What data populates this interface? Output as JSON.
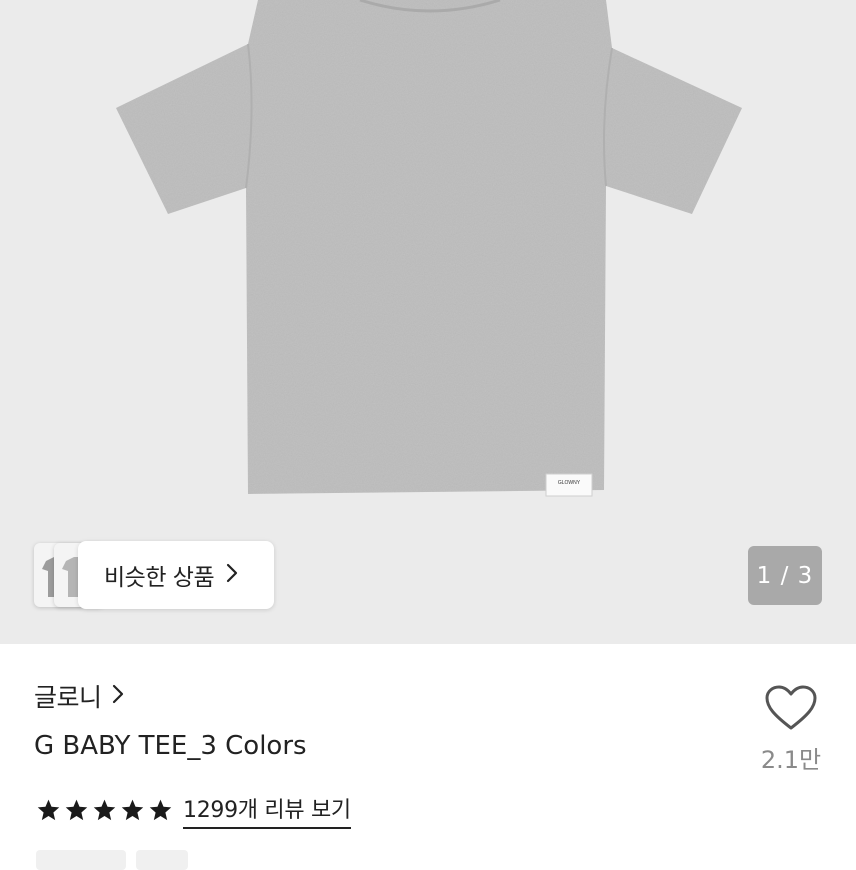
{
  "hero": {
    "image_label": "GLOWNY",
    "similar": {
      "label": "비슷한 상품",
      "icon": "chevron-right-icon"
    },
    "page_indicator": "1 / 3"
  },
  "product": {
    "brand": "글로니",
    "brand_icon": "chevron-right-icon",
    "title": "G BABY TEE_3 Colors",
    "rating": 5,
    "review_link": "1299개 리뷰 보기",
    "like_icon": "heart-outline-icon",
    "like_count": "2.1만"
  },
  "colors": {
    "background_hero": "#ebebeb",
    "shirt": "#bdbdbd",
    "star": "#1a1a1a",
    "badge": "#a9a9a9",
    "muted_text": "#8a8a8a"
  }
}
